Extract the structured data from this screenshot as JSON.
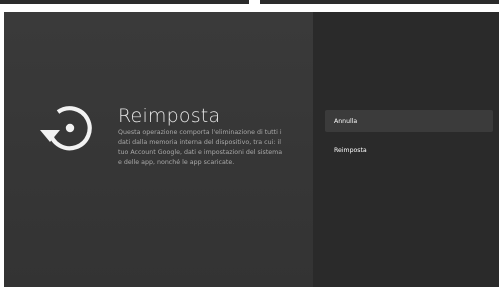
{
  "dialog": {
    "title": "Reimposta",
    "description": "Questa operazione comporta l'eliminazione di tutti i dati dalla memoria interna del dispositivo, tra cui: il tuo Account Google, dati e impostazioni del sistema e delle app, nonché le app scaricate.",
    "icon": "reset-icon"
  },
  "options": [
    {
      "label": "Annulla",
      "focused": true
    },
    {
      "label": "Reimposta",
      "focused": false
    }
  ],
  "colors": {
    "left_pane": "#363636",
    "right_pane": "#2a2a2a",
    "focused_option": "#3b3b3b",
    "text_primary": "#e6e6e6",
    "text_secondary": "#a8a8a8"
  }
}
